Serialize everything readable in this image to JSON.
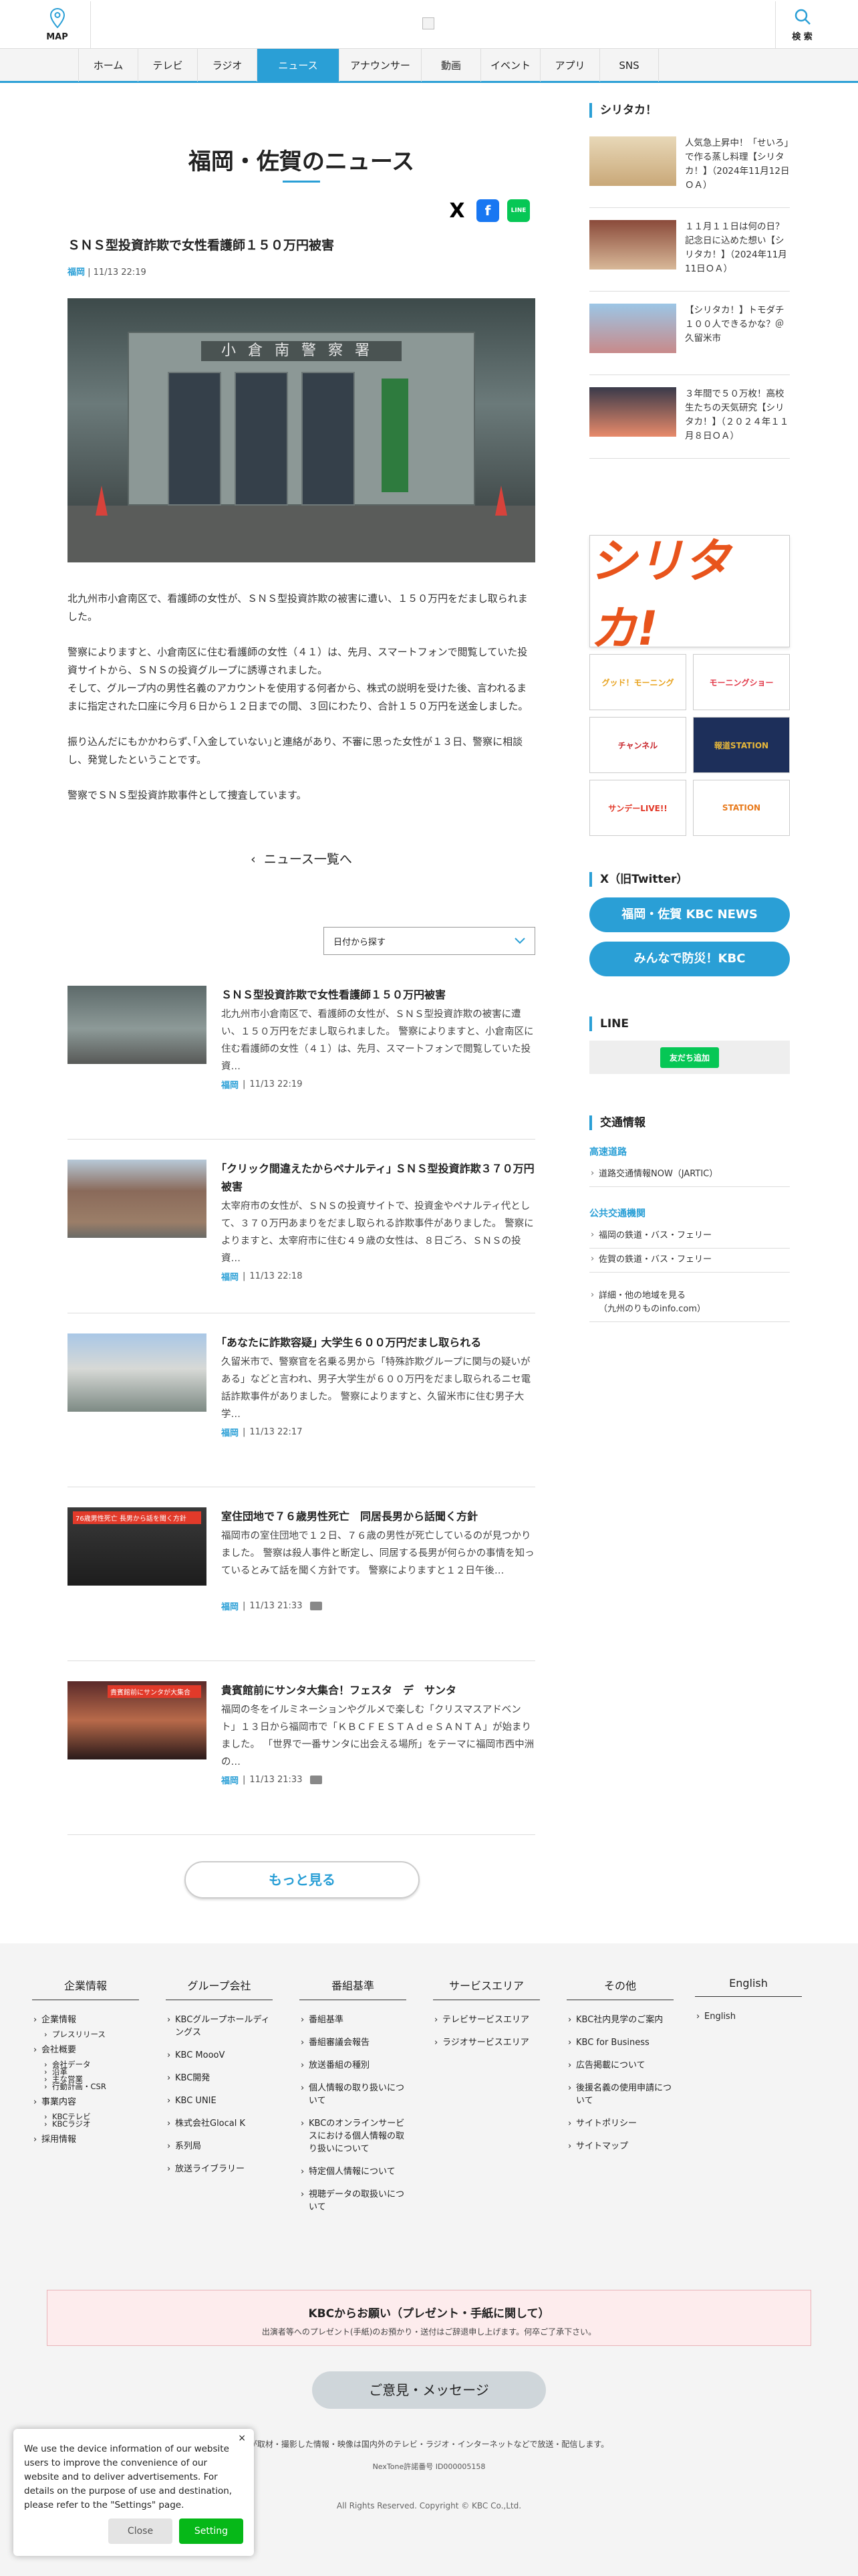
{
  "header": {
    "map_label": "MAP",
    "search_label": "検 索"
  },
  "nav": [
    "ホーム",
    "テレビ",
    "ラジオ",
    "ニュース",
    "アナウンサー",
    "動画",
    "イベント",
    "アプリ",
    "SNS"
  ],
  "page_title": "福岡・佐賀のニュース",
  "share": {
    "x": "X",
    "facebook": "f",
    "line": "LINE"
  },
  "article": {
    "headline": "ＳＮＳ型投資詐欺で女性看護師１５０万円被害",
    "pref": "福岡",
    "time": "11/13 22:19",
    "hero_sign": "小倉南警察署",
    "paragraphs": [
      "北九州市小倉南区で、看護師の女性が、ＳＮＳ型投資詐欺の被害に遭い、１５０万円をだまし取られました。",
      "警察によりますと、小倉南区に住む看護師の女性（４１）は、先月、スマートフォンで閲覧していた投資サイトから、ＳＮＳの投資グループに誘導されました。\nそして、グループ内の男性名義のアカウントを使用する何者から、株式の説明を受けた後、言われるままに指定された口座に今月６日から１２日までの間、３回にわたり、合計１５０万円を送金しました。",
      "振り込んだにもかかわらず､｢入金していない｣と連絡があり、不審に思った女性が１３日、警察に相談し、発覚したということです。",
      "警察でＳＮＳ型投資詐欺事件として捜査しています。"
    ]
  },
  "back_link": "ニュース一覧へ",
  "date_select": "日付から探す",
  "news": [
    {
      "title": "ＳＮＳ型投資詐欺で女性看護師１５０万円被害",
      "summary": "北九州市小倉南区で、看護師の女性が、ＳＮＳ型投資詐欺の被害に遭い、１５０万円をだまし取られました。 警察によりますと、小倉南区に住む看護師の女性（４１）は、先月、スマートフォンで閲覧していた投資…",
      "pref": "福岡",
      "time": "11/13 22:19"
    },
    {
      "title": "｢クリック間違えたからペナルティ｣ ＳＮＳ型投資詐欺３７０万円被害",
      "summary": "太宰府市の女性が、ＳＮＳの投資サイトで、投資金やペナルティ代として、３７０万円あまりをだまし取られる詐欺事件がありました。 警察によりますと、太宰府市に住む４９歳の女性は、８日ごろ、ＳＮＳの投資…",
      "pref": "福岡",
      "time": "11/13 22:18"
    },
    {
      "title": "｢あなたに詐欺容疑｣ 大学生６００万円だまし取られる",
      "summary": "久留米市で、警察官を名乗る男から「特殊詐欺グループに関与の疑いがある」などと言われ、男子大学生が６００万円をだまし取られるニセ電話詐欺事件がありました。 警察によりますと、久留米市に住む男子大学…",
      "pref": "福岡",
      "time": "11/13 22:17"
    },
    {
      "title": "室住団地で７６歳男性死亡　同居長男から話聞く方針",
      "summary": "福岡市の室住団地で１２日、７６歳の男性が死亡しているのが見つかりました。 警察は殺人事件と断定し、同居する長男が何らかの事情を知っているとみて話を聞く方針です。 警察によりますと１２日午後…",
      "pref": "福岡",
      "time": "11/13 21:33",
      "video": true,
      "thumb_caption": "76歳男性死亡 長男から話を聞く方針"
    },
    {
      "title": "貴賓館前にサンタ大集合！フェスタ　デ　サンタ",
      "summary": "福岡の冬をイルミネーションやグルメで楽しむ「クリスマスアドベント」１３日から福岡市で「ＫＢＣＦＥＳＴＡｄｅＳＡＮＴＡ」が始まりました。 「世界で一番サンタに出会える場所」をテーマに福岡市西中洲の…",
      "pref": "福岡",
      "time": "11/13 21:33",
      "video": true,
      "thumb_caption": "貴賓館前にサンタが大集合"
    }
  ],
  "more_button": "もっと見る",
  "sidebar": {
    "shiritaka_head": "シリタカ！",
    "shiritaka_items": [
      "人気急上昇中！「せいろ」で作る蒸し料理【シリタカ！】（2024年11月12日ＯＡ）",
      "１１月１１日は何の日？記念日に込めた想い【シリタカ！】（2024年11月11日ＯＡ）",
      "【シリタカ！】トモダチ１００人できるかな？＠久留米市",
      "３年間で５０万枚！高校生たちの天気研究【シリタカ！】（２０２４年１１月８日ＯＡ）"
    ],
    "banner_text": "シリタカ!",
    "programs": [
      "グッド！モーニング",
      "モーニングショー",
      "チャンネル",
      "報道STATION",
      "サンデーLIVE!!",
      "STATION"
    ],
    "x_head": "X（旧Twitter）",
    "x_buttons": [
      "福岡・佐賀 KBC NEWS",
      "みんなで防災！KBC"
    ],
    "line_head": "LINE",
    "line_add": "友だち追加",
    "traffic_head": "交通情報",
    "traffic_highway": "高速道路",
    "traffic_highway_link": "道路交通情報NOW（JARTIC）",
    "traffic_public": "公共交通機関",
    "traffic_public_links": [
      "福岡の鉄道・バス・フェリー",
      "佐賀の鉄道・バス・フェリー"
    ],
    "traffic_more": "詳細・他の地域を見る\n（九州のりものinfo.com）"
  },
  "footer": {
    "columns": [
      {
        "head": "企業情報",
        "items": [
          [
            "企業情報",
            false
          ],
          [
            "プレスリリース",
            true
          ],
          [
            "会社概要",
            false
          ],
          [
            "会社データ",
            true
          ],
          [
            "沿革",
            true
          ],
          [
            "主な営業",
            true
          ],
          [
            "行動計画・CSR",
            true
          ],
          [
            "事業内容",
            false
          ],
          [
            "KBCテレビ",
            true
          ],
          [
            "KBCラジオ",
            true
          ],
          [
            "採用情報",
            false
          ]
        ]
      },
      {
        "head": "グループ会社",
        "items": [
          [
            "KBCグループホールディングス",
            false
          ],
          [
            "KBC MoooV",
            false
          ],
          [
            "KBC開発",
            false
          ],
          [
            "KBC UNIE",
            false
          ],
          [
            "株式会社Glocal K",
            false
          ],
          [
            "系列局",
            false
          ],
          [
            "放送ライブラリー",
            false
          ]
        ]
      },
      {
        "head": "番組基準",
        "items": [
          [
            "番組基準",
            false
          ],
          [
            "番組審議会報告",
            false
          ],
          [
            "放送番組の種別",
            false
          ],
          [
            "個人情報の取り扱いについて",
            false
          ],
          [
            "KBCのオンラインサービスにおける個人情報の取り扱いについて",
            false
          ],
          [
            "特定個人情報について",
            false
          ],
          [
            "視聴データの取扱いについて",
            false
          ]
        ]
      },
      {
        "head": "サービスエリア",
        "items": [
          [
            "テレビサービスエリア",
            false
          ],
          [
            "ラジオサービスエリア",
            false
          ]
        ]
      },
      {
        "head": "その他",
        "items": [
          [
            "KBC社内見学のご案内",
            false
          ],
          [
            "KBC for Business",
            false
          ],
          [
            "広告掲載について",
            false
          ],
          [
            "後援名義の使用申請について",
            false
          ],
          [
            "サイトポリシー",
            false
          ],
          [
            "サイトマップ",
            false
          ]
        ]
      },
      {
        "head": "English",
        "items": [
          [
            "English",
            false
          ]
        ]
      }
    ],
    "present_title": "KBCからお願い（プレゼント・手紙に関して）",
    "present_text": "出演者等へのプレゼント(手紙)のお預かり・送付はご辞退申し上げます。何卒ご了承下さい。",
    "opinion": "ご意見・メッセージ",
    "notice": "が取材・撮影した情報・映像は国内外のテレビ・ラジオ・インターネットなどで放送・配信します。",
    "nextone": "NexTone許諾番号 ID000005158",
    "copyright": "All Rights Reserved. Copyright © KBC Co.,Ltd."
  },
  "cookie": {
    "text": "We use the device information of our website users to improve the convenience of our website and to deliver advertisements. For details on the purpose of use and destination, please refer to the \"Settings\" page.",
    "close_x": "×",
    "close": "Close",
    "setting": "Setting"
  },
  "colors": {
    "accent": "#2a9fd6",
    "line_green": "#06c755"
  }
}
